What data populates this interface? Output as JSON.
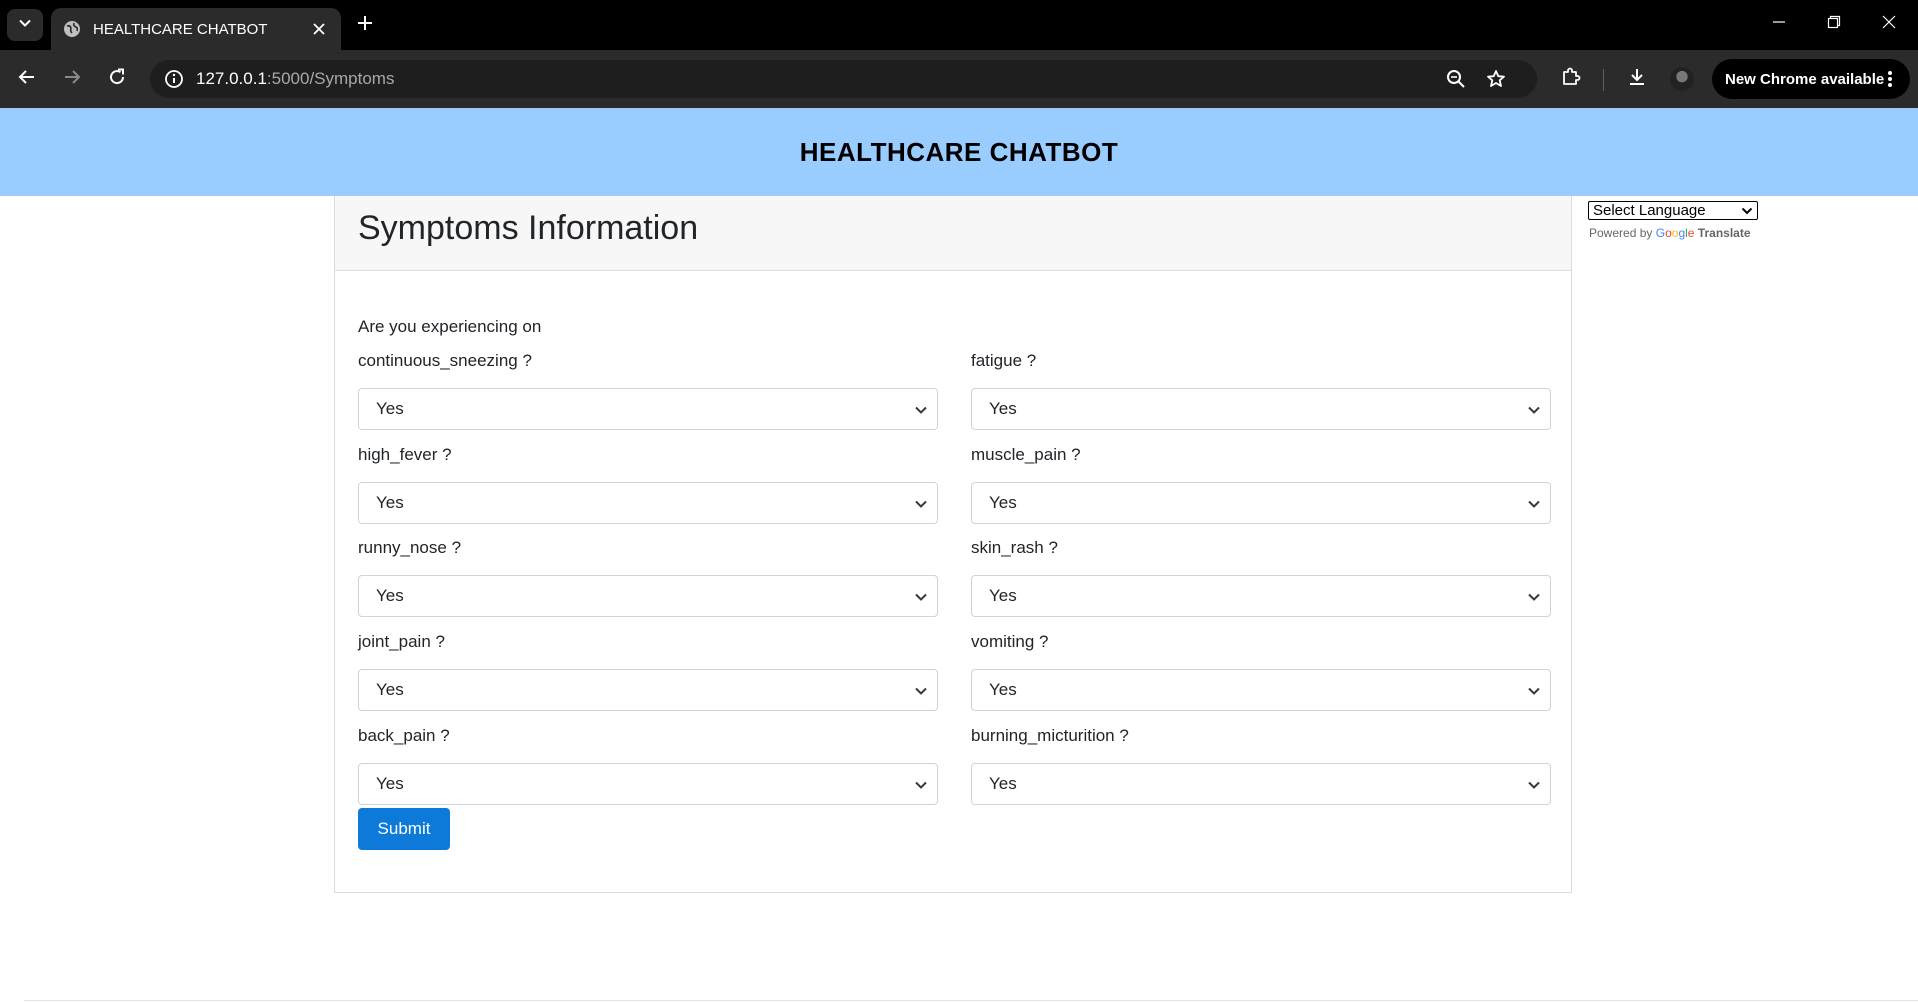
{
  "browser": {
    "tab_title": "HEALTHCARE CHATBOT",
    "url_host": "127.0.0.1",
    "url_rest": ":5000/Symptoms",
    "update_label": "New Chrome available"
  },
  "header": {
    "title": "HEALTHCARE CHATBOT"
  },
  "card": {
    "title": "Symptoms Information",
    "intro": "Are you experiencing on",
    "fields": [
      {
        "label": "continuous_sneezing ?",
        "value": "Yes"
      },
      {
        "label": "fatigue ?",
        "value": "Yes"
      },
      {
        "label": "high_fever ?",
        "value": "Yes"
      },
      {
        "label": "muscle_pain ?",
        "value": "Yes"
      },
      {
        "label": "runny_nose ?",
        "value": "Yes"
      },
      {
        "label": "skin_rash ?",
        "value": "Yes"
      },
      {
        "label": "joint_pain ?",
        "value": "Yes"
      },
      {
        "label": "vomiting ?",
        "value": "Yes"
      },
      {
        "label": "back_pain ?",
        "value": "Yes"
      },
      {
        "label": "burning_micturition ?",
        "value": "Yes"
      }
    ],
    "submit_label": "Submit"
  },
  "translate": {
    "select_label": "Select Language",
    "powered_by": "Powered by",
    "google_g": "G",
    "google_o1": "o",
    "google_o2": "o",
    "google_g2": "g",
    "google_l": "l",
    "google_e": "e",
    "translate_word": "Translate"
  },
  "colors": {
    "header_bg": "#99ccff",
    "button_bg": "#0d79d9"
  }
}
